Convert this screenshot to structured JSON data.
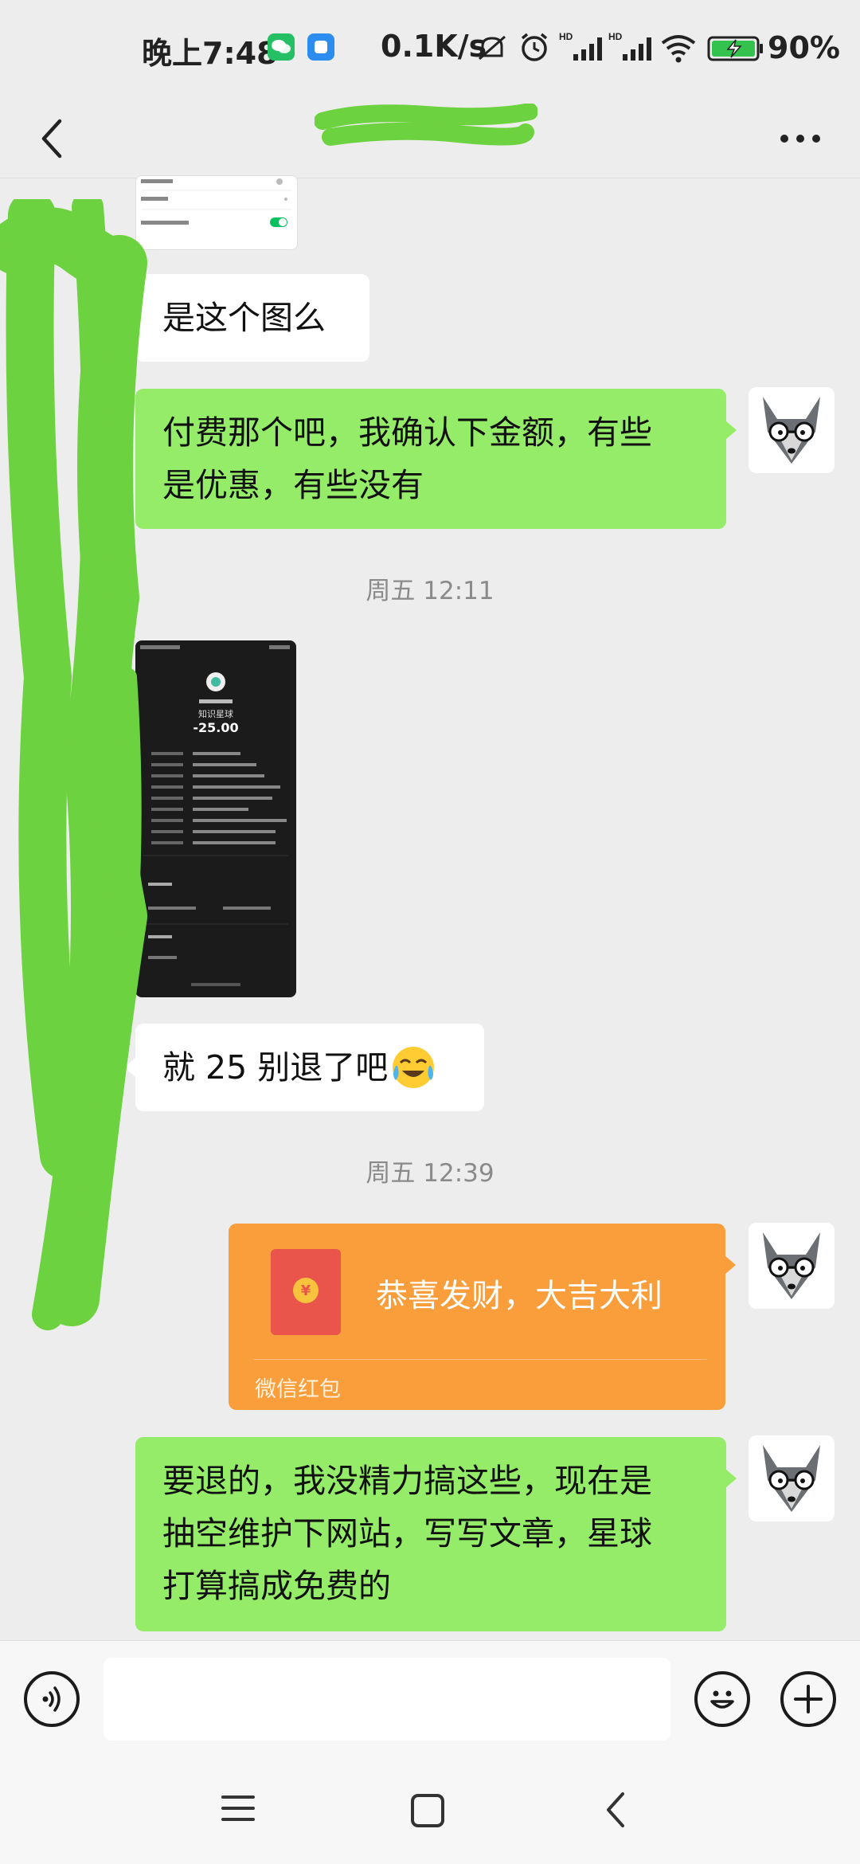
{
  "status_bar": {
    "time": "晚上7:48",
    "network_speed": "0.1K/s",
    "battery": "90%",
    "icons": [
      "wechat-app-icon",
      "blue-app-icon",
      "mute-icon",
      "alarm-icon",
      "signal-icon",
      "signal-icon",
      "wifi-icon",
      "battery-charging-icon"
    ]
  },
  "nav": {
    "back_icon": "chevron-left-icon",
    "more_icon": "more-dots-icon"
  },
  "messages": [
    {
      "type": "image",
      "side": "left",
      "desc_icon": "settings-screenshot"
    },
    {
      "type": "text",
      "side": "left",
      "text": "是这个图么"
    },
    {
      "type": "text",
      "side": "right",
      "lines": [
        "付费那个吧，我确认下金额，有些",
        "是优惠，有些没有"
      ]
    },
    {
      "type": "time",
      "text": "周五 12:11"
    },
    {
      "type": "image",
      "side": "left",
      "amount": "-25.00",
      "merchant": "知识星球"
    },
    {
      "type": "text",
      "side": "left",
      "text": "就 25 别退了吧",
      "emoji": "crying-laughing-emoji"
    },
    {
      "type": "time",
      "text": "周五 12:39"
    },
    {
      "type": "redpacket",
      "side": "right",
      "title": "恭喜发财，大吉大利",
      "label": "微信红包"
    },
    {
      "type": "text",
      "side": "right",
      "lines": [
        "要退的，我没精力搞这些，现在是",
        "抽空维护下网站，写写文章，星球",
        "打算搞成免费的"
      ]
    }
  ],
  "input_bar": {
    "voice_icon": "voice-icon",
    "emoji_icon": "emoji-icon",
    "plus_icon": "plus-icon"
  },
  "colors": {
    "background": "#ededed",
    "my_bubble": "#95ec69",
    "their_bubble": "#ffffff",
    "redpacket": "#fa9d3b",
    "scribble": "#6dd23f"
  }
}
